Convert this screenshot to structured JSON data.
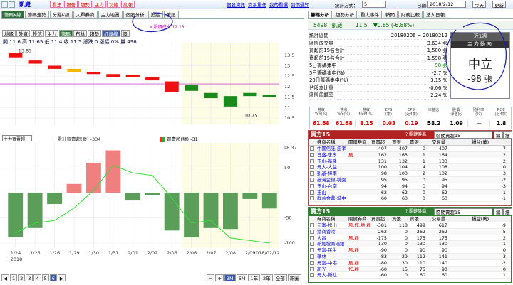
{
  "topbar": {
    "stock": "凱崴",
    "buttons": [
      "看法",
      "報告",
      "趨勢",
      "主力",
      "功能",
      "亂報"
    ],
    "links": [
      "個股資訊",
      "交易重任",
      "我的重選",
      "到價通知"
    ],
    "right_label": "統計方式：",
    "right_value": "5",
    "date_label": "日期:",
    "date_value": "2018/2/12",
    "today_btn": "今天",
    "refresh_btn": "更新"
  },
  "left_tabs": [
    "籌碼K線",
    "籌碼走勢",
    "分點K線",
    "大單券商",
    "主力地圖",
    "個股分析",
    "追蹤",
    "筆記"
  ],
  "toolbar": [
    "地緣",
    "外資",
    "投信",
    "主力",
    "籌碼",
    "布林",
    "趨勢",
    "紅綠線",
    "設"
  ],
  "ohlc_line": "開 11.6  高 11.65  低 11.4  收 11.5  漲跌 0  漲幅 0%  量 496",
  "upper_legend": "股價成本 12.13",
  "upper_yticks": [
    "13.5",
    "13",
    "12.5",
    "12",
    "11.5",
    "11",
    "10.5"
  ],
  "upper_labels": {
    "high": "13.85",
    "low": "10.75"
  },
  "lower_panel": {
    "select": "主力買賣超",
    "legend1": "一累計買賣超(張) -334",
    "legend2": "買賣超(張) -31",
    "ytick_top": "98.37",
    "yticks": [
      "50",
      "-50",
      "-100"
    ]
  },
  "xlabels": [
    "1/24",
    "1/25",
    "1/26",
    "1/29",
    "1/30",
    "1/31",
    "2/01",
    "2/02",
    "2/05",
    "2/06",
    "2/07",
    "2/08",
    "2/09"
  ],
  "x_year": "2018",
  "x_end": "2018/02/12",
  "bottom_pager": [
    "1",
    "2",
    "3",
    "4",
    "5",
    "6"
  ],
  "bottom_zoom": [
    "3M",
    "6M",
    "1年",
    "2年",
    "全部",
    "新圖"
  ],
  "right_tabs": [
    "籌碼分析",
    "趨勢分析",
    "重大事件",
    "新聞",
    "財務比較",
    "法人日報"
  ],
  "quote": {
    "code": "5498",
    "name": "凱崴",
    "price": "11.5",
    "change": "▼0.85 (-6.88%)"
  },
  "stats": [
    {
      "label": "統計區間",
      "value": "20180206 ~ 20180212",
      "cls": ""
    },
    {
      "label": "區間成交量",
      "value": "3,634 張",
      "cls": ""
    },
    {
      "label": "買超前15名合計",
      "value": "1,500 張",
      "cls": ""
    },
    {
      "label": "賣超前15名合計",
      "value": "-1,598 張",
      "cls": ""
    },
    {
      "label": "5日籌碼集中",
      "value": "-98 張",
      "cls": "grn"
    },
    {
      "label": "5日籌碼集中(%)",
      "value": "-2.7 %",
      "cls": ""
    },
    {
      "label": "20日籌碼集中(%)",
      "value": "3.15 %",
      "cls": ""
    },
    {
      "label": "佔股本比重",
      "value": "-0.06 %",
      "cls": ""
    },
    {
      "label": "區間周轉率",
      "value": "2.24 %",
      "cls": ""
    }
  ],
  "sentiment": {
    "period": "近1週",
    "title": "主力動向",
    "status": "中立",
    "value": "-98 張"
  },
  "metrics": {
    "headers": [
      "營收\nYoY(%)",
      "營收\nYoY(%)",
      "營收\nMoM(%)",
      "EPS\n(季)",
      "EPS\n(近4季)",
      "本益比",
      "股價\n淨值比",
      "殖利率\n(%)",
      "ROE\n(近4季)"
    ],
    "values": [
      "61.68",
      "61.68",
      "8.15",
      "0.03",
      "0.19",
      "58.2",
      "1.09",
      "—",
      "1.8"
    ]
  },
  "buy_table": {
    "title": "買方15",
    "hint": "關鍵券商:",
    "select": "區間買超15",
    "btn1": "編",
    "btn2": "細",
    "headers": [
      "券商名稱",
      "關鍵券商",
      "買賣超",
      "買張",
      "賣張",
      "交易量",
      "損益(萬)"
    ],
    "rows": [
      [
        "中國信託-忠孝",
        "",
        "407",
        "407",
        "0",
        "407",
        "-7"
      ],
      [
        "日盛-忠孝",
        "風",
        "162",
        "163",
        "1",
        "164",
        "2"
      ],
      [
        "玉山-基隆",
        "",
        "131",
        "132",
        "1",
        "133",
        "2"
      ],
      [
        "元大-大益",
        "",
        "100",
        "104",
        "4",
        "108",
        "0"
      ],
      [
        "凱基-樟南",
        "",
        "98",
        "100",
        "2",
        "102",
        "3"
      ],
      [
        "臺灣企銀-桃園",
        "",
        "95",
        "95",
        "0",
        "95",
        "-2"
      ],
      [
        "玉山-台南",
        "",
        "94",
        "94",
        "0",
        "94",
        "-3"
      ],
      [
        "玉山",
        "",
        "62",
        "62",
        "0",
        "62",
        "-1"
      ],
      [
        "群益金鼎-城中",
        "",
        "60",
        "60",
        "0",
        "60",
        "-1"
      ]
    ]
  },
  "sell_table": {
    "title": "賣方15",
    "hint": "關鍵券商:",
    "select": "區間賣超15",
    "btn1": "編",
    "btn2": "細",
    "headers": [
      "券商名稱",
      "關鍵券商",
      "買賣超",
      "買張",
      "賣張",
      "交易量",
      "損益(萬)"
    ],
    "rows": [
      [
        "元富-松山",
        "風,作,地,顧",
        "-381",
        "118",
        "499",
        "617",
        "-9"
      ],
      [
        "港商香港",
        "",
        "-262",
        "0",
        "262",
        "262",
        "5"
      ],
      [
        "大昌",
        "風,顧",
        "-175",
        "0",
        "175",
        "175",
        "2"
      ],
      [
        "新加坡商瑞銀",
        "",
        "-130",
        "0",
        "130",
        "130",
        "1"
      ],
      [
        "元富-民生",
        "風,顧",
        "-90",
        "0",
        "90",
        "90",
        "0"
      ],
      [
        "華林",
        "",
        "-83",
        "29",
        "112",
        "141",
        "3"
      ],
      [
        "元富-中港",
        "風,顧",
        "-80",
        "30",
        "110",
        "140",
        "-2"
      ],
      [
        "新光",
        "作,顧",
        "-60",
        "15",
        "75",
        "90",
        "0"
      ],
      [
        "元大-新社",
        "",
        "-60",
        "0",
        "60",
        "60",
        "1"
      ]
    ]
  },
  "chart_data": {
    "type": "candlestick",
    "categories": [
      "1/24",
      "1/25",
      "1/26",
      "1/29",
      "1/30",
      "1/31",
      "2/01",
      "2/02",
      "2/05",
      "2/06",
      "2/07",
      "2/08",
      "2/09",
      "2/12"
    ],
    "price": {
      "open": [
        13.6,
        13.25,
        13.0,
        12.85,
        12.7,
        12.6,
        12.55,
        12.45,
        12.25,
        12.1,
        11.7,
        11.55,
        11.7,
        11.6
      ],
      "close": [
        13.4,
        13.1,
        12.85,
        12.7,
        12.6,
        12.45,
        12.45,
        12.3,
        11.75,
        11.8,
        11.45,
        11.05,
        11.55,
        11.5
      ],
      "color": [
        "red",
        "red",
        "red",
        "orange",
        "red",
        "red",
        "red",
        "red",
        "red",
        "green",
        "green",
        "green",
        "green",
        "green"
      ],
      "ylim": [
        10.4,
        13.9
      ]
    },
    "avg_cost": 12.13,
    "net_buy": {
      "values": [
        -88,
        -70,
        -22,
        18,
        60,
        85,
        -15,
        -5,
        -75,
        -88,
        -70,
        -72,
        -12,
        -31
      ],
      "color": [
        "green",
        "green",
        "green",
        "red",
        "red",
        "red",
        "green",
        "green",
        "green",
        "green",
        "green",
        "green",
        "green",
        "green"
      ]
    },
    "cumulative": {
      "values": [
        -80,
        -60,
        -55,
        -30,
        5,
        55,
        40,
        35,
        -10,
        -60,
        -55,
        -90,
        -95,
        -100
      ]
    },
    "ylim_lower": [
      -110,
      100
    ]
  }
}
